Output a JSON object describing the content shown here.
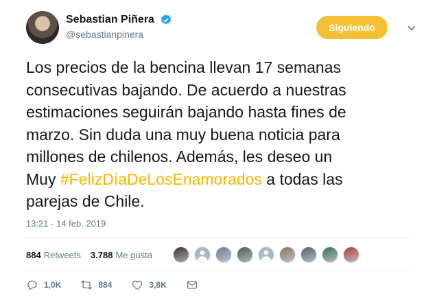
{
  "author": {
    "display_name": "Sebastian Piñera",
    "handle": "@sebastianpinera",
    "verified": true
  },
  "follow_button": {
    "label": "Siguiendo",
    "color": "#f5c033"
  },
  "tweet": {
    "text_before": "Los precios de la bencina llevan 17 semanas\nconsecutivas bajando. De acuerdo a nuestras\nestimaciones seguirán bajando hasta fines de\nmarzo. Sin duda una muy buena noticia para\nmillones de chilenos. Además, les deseo un\nMuy ",
    "hashtag": "#FelizDíaDeLosEnamorados",
    "text_after": " a todas las\nparejas de Chile.",
    "hashtag_color": "#f5b800"
  },
  "timestamp": "13:21 - 14 feb. 2019",
  "stats": {
    "retweets_count": "884",
    "retweets_label": "Retweets",
    "likes_count": "3.788",
    "likes_label": "Me gusta"
  },
  "likers": [
    {
      "icon": "avatar-photo",
      "color": "#3a2f2a"
    },
    {
      "icon": "default-avatar",
      "color": "#aab8c2"
    },
    {
      "icon": "avatar-photo",
      "color": "#6f7f95"
    },
    {
      "icon": "avatar-photo",
      "color": "#4a5a4f"
    },
    {
      "icon": "default-avatar",
      "color": "#aab8c2"
    },
    {
      "icon": "avatar-photo",
      "color": "#8a7560"
    },
    {
      "icon": "avatar-photo",
      "color": "#56606c"
    },
    {
      "icon": "avatar-photo",
      "color": "#3d6e5a"
    },
    {
      "icon": "avatar-photo",
      "color": "#a94437"
    }
  ],
  "actions": {
    "reply_count": "1,0K",
    "retweet_count": "884",
    "like_count": "3,8K"
  },
  "colors": {
    "secondary_text": "#657786",
    "divider": "#e6ecf0"
  }
}
